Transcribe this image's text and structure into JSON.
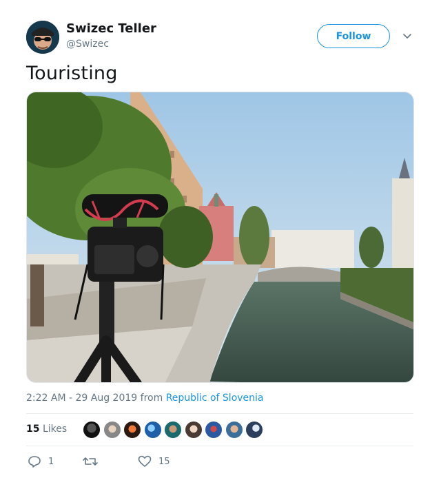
{
  "user": {
    "name": "Swizec Teller",
    "handle": "@Swizec"
  },
  "follow_label": "Follow",
  "tweet": {
    "text": "Touristing",
    "time": "2:22 AM - 29 Aug 2019",
    "from_word": "from",
    "location": "Republic of Slovenia"
  },
  "engagement": {
    "likes_count": "15",
    "likes_label": "Likes",
    "liker_count": 9
  },
  "actions": {
    "reply_count": "1",
    "retweet_count": "",
    "like_count": "15"
  },
  "icons": [
    "chevron-down-icon",
    "reply-icon",
    "retweet-icon",
    "heart-icon"
  ],
  "colors": {
    "accent": "#1b95e0",
    "muted": "#657786",
    "text": "#14171a"
  }
}
